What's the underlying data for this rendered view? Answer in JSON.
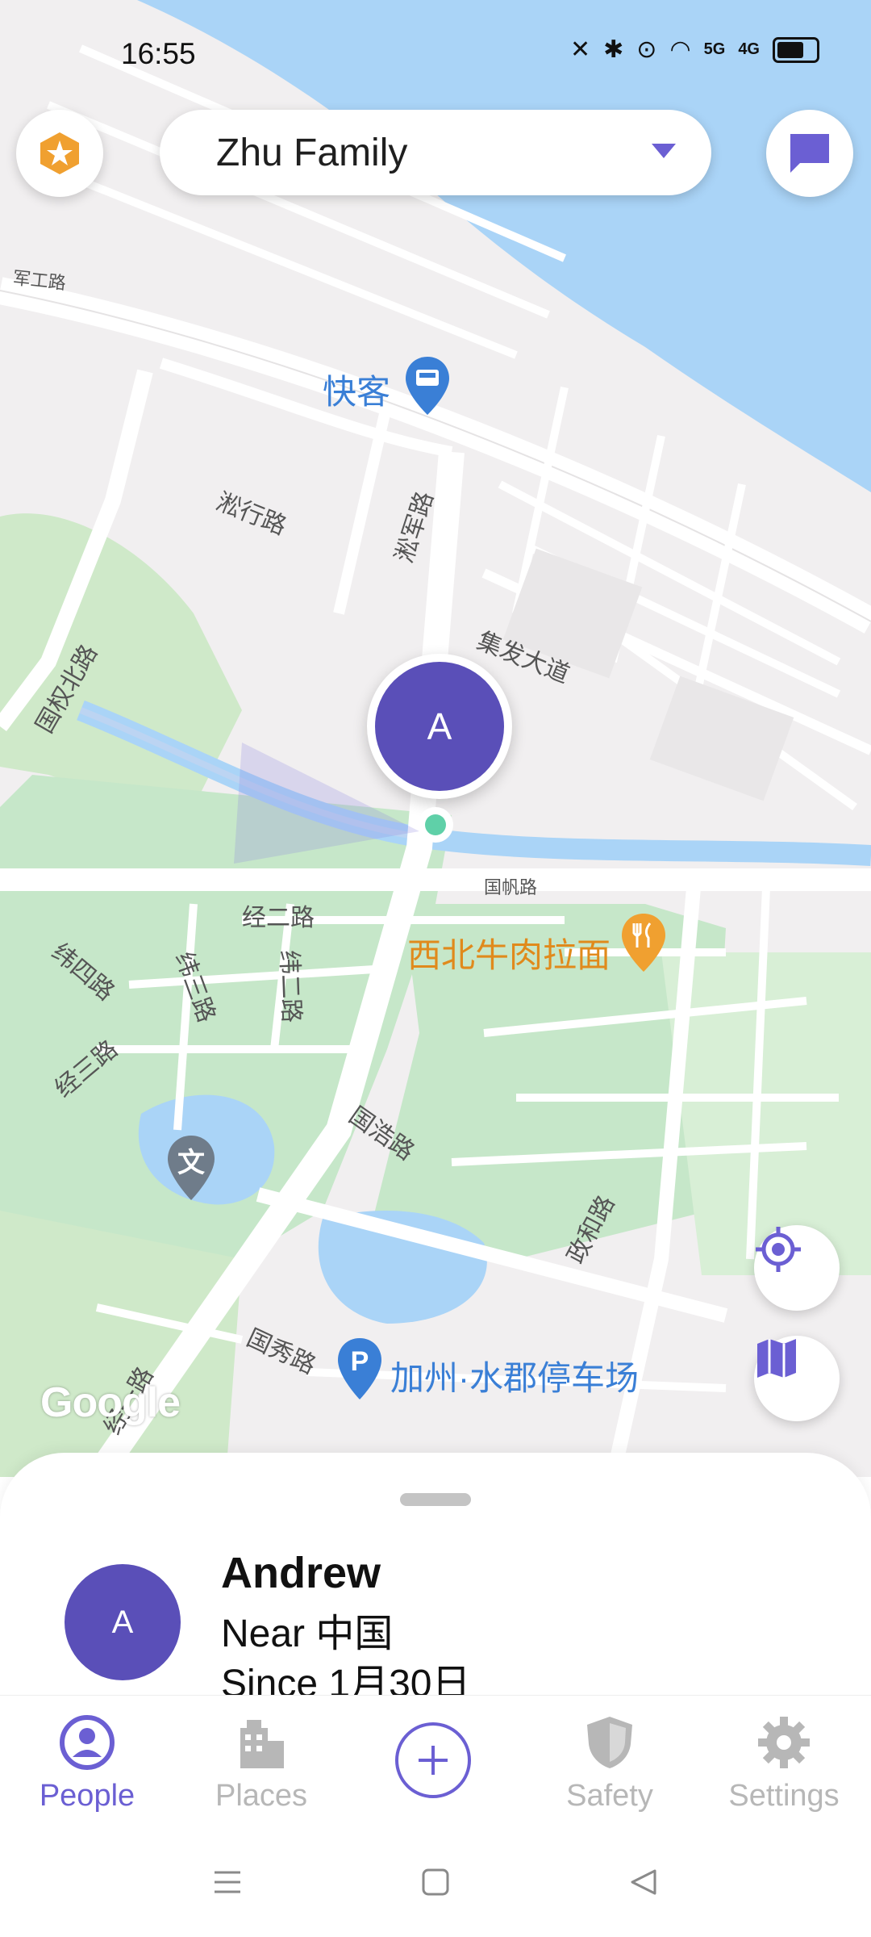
{
  "status_bar": {
    "time": "16:55",
    "net1": "5G",
    "net2": "4G"
  },
  "header": {
    "family_name": "Zhu Family"
  },
  "map": {
    "road_labels": [
      "军工路",
      "淞行路",
      "淞军路",
      "集发大道",
      "国权北路",
      "国帆路",
      "经二路",
      "纬四路",
      "纬三路",
      "纬二路",
      "经三路",
      "国浩路",
      "政和路",
      "国秀路",
      "经一路"
    ],
    "poi_labels": [
      "快客",
      "西北牛肉拉面",
      "加州·水郡停车场"
    ],
    "poi_icon_text": "文",
    "attribution": "Google",
    "marker_initial": "A"
  },
  "member": {
    "initial": "A",
    "name": "Andrew",
    "location": "Near 中国",
    "since": "Since 1月30日"
  },
  "nav": {
    "people": "People",
    "places": "Places",
    "safety": "Safety",
    "settings": "Settings"
  },
  "colors": {
    "accent": "#6b5fd3",
    "avatar": "#5a4fb8",
    "water": "#aad4f7",
    "park": "#c6e7c9",
    "poi_orange": "#e08a1c",
    "poi_blue": "#3a7fd6"
  }
}
